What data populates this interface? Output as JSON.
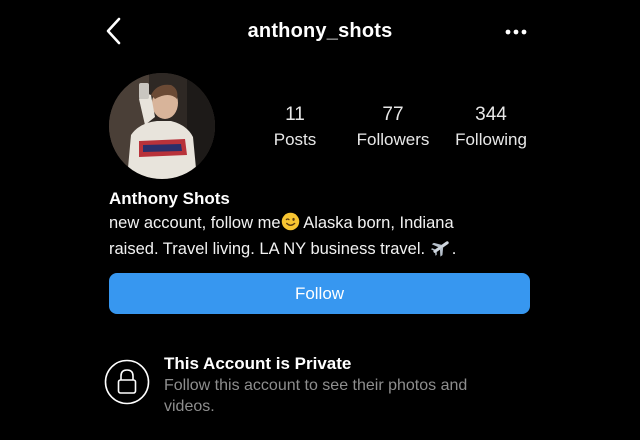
{
  "header": {
    "username": "anthony_shots",
    "back_icon": "chevron-left-icon",
    "more_icon": "more-horizontal-icon"
  },
  "profile": {
    "stats": [
      {
        "value": "11",
        "label": "Posts"
      },
      {
        "value": "77",
        "label": "Followers"
      },
      {
        "value": "344",
        "label": "Following"
      }
    ],
    "display_name": "Anthony Shots",
    "bio": {
      "line1_a": "new account, follow me",
      "line1_b": " Alaska born, Indiana",
      "line2_a": "raised. Travel living. LA NY business travel. ",
      "line2_b": "."
    }
  },
  "actions": {
    "follow_label": "Follow"
  },
  "private_notice": {
    "title": "This Account is Private",
    "subtitle": "Follow this account to see their photos and videos."
  },
  "colors": {
    "background": "#000000",
    "follow_button": "#3797f0",
    "secondary_text": "#8e8e8e"
  }
}
